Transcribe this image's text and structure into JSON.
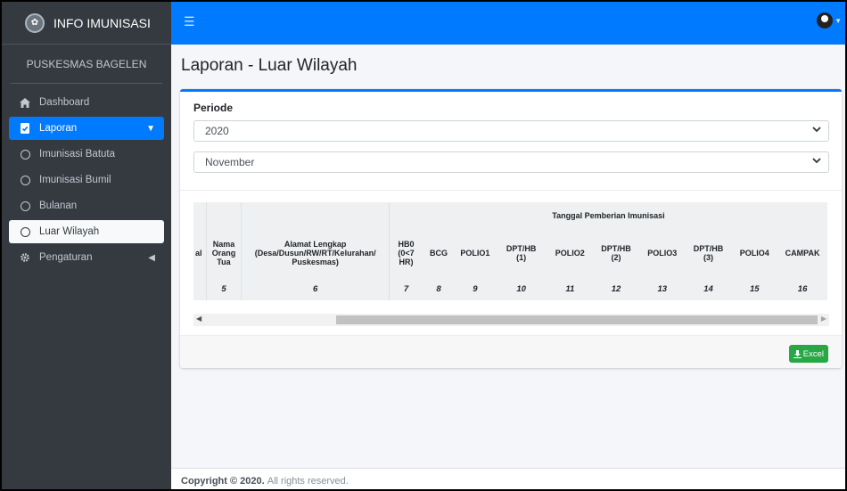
{
  "brand": {
    "title": "INFO IMUNISASI",
    "logo_icon": "seal-logo"
  },
  "org": "PUSKESMAS BAGELEN",
  "sidebar": {
    "items": [
      {
        "label": "Dashboard",
        "icon": "home-icon"
      },
      {
        "label": "Laporan",
        "icon": "file-icon"
      },
      {
        "label": "Imunisasi Batuta",
        "icon": "circle-icon"
      },
      {
        "label": "Imunisasi Bumil",
        "icon": "circle-icon"
      },
      {
        "label": "Bulanan",
        "icon": "circle-icon"
      },
      {
        "label": "Luar Wilayah",
        "icon": "circle-icon"
      },
      {
        "label": "Pengaturan",
        "icon": "gear-icon"
      }
    ]
  },
  "page": {
    "title": "Laporan - Luar Wilayah"
  },
  "filter": {
    "label": "Periode",
    "year": "2020",
    "month": "November"
  },
  "table": {
    "group_header": "Tanggal Pemberian Imunisasi",
    "partial_left": "al",
    "nama_orang_tua": [
      "Nama",
      "Orang",
      "Tua"
    ],
    "alamat": [
      "Alamat Lengkap",
      "(Desa/Dusun/RW/RT/Kelurahan/",
      "Puskesmas)"
    ],
    "hb0": [
      "HB0",
      "(0<7",
      "HR)"
    ],
    "columns": [
      "BCG",
      "POLIO1",
      "POLIO2",
      "POLIO3",
      "POLIO4",
      "CAMPAK"
    ],
    "dpt1": [
      "DPT/HB",
      "(1)"
    ],
    "dpt2": [
      "DPT/HB",
      "(2)"
    ],
    "dpt3": [
      "DPT/HB",
      "(3)"
    ],
    "numbers": [
      "5",
      "6",
      "7",
      "8",
      "9",
      "10",
      "11",
      "12",
      "13",
      "14",
      "15",
      "16"
    ]
  },
  "actions": {
    "excel": "Excel"
  },
  "footer": {
    "copyright": "Copyright © 2020.",
    "rights": "All rights reserved."
  },
  "colors": {
    "primary": "#007bff",
    "sidebar": "#343a40",
    "success": "#28a745"
  }
}
